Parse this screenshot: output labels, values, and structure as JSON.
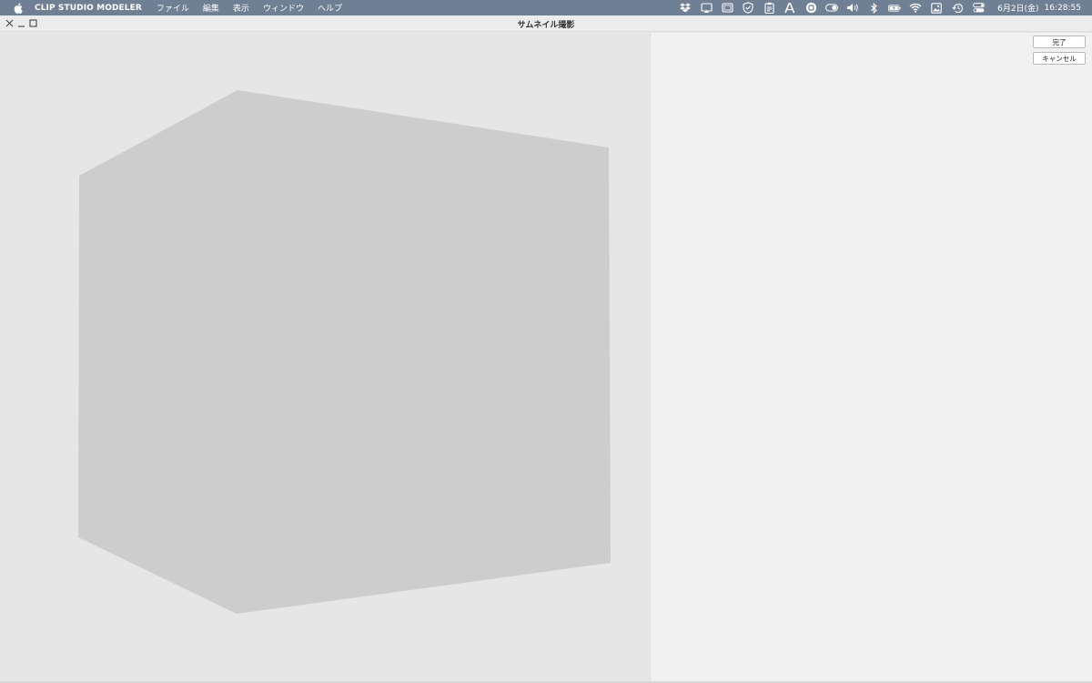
{
  "menubar": {
    "app_name": "CLIP STUDIO MODELER",
    "items": [
      "ファイル",
      "編集",
      "表示",
      "ウィンドウ",
      "ヘルプ"
    ],
    "status_icons": [
      "dropbox-icon",
      "airplay-display-icon",
      "screen-icon",
      "shield-icon",
      "clipboard-icon",
      "text-a-icon",
      "circle-s-icon",
      "toggle-icon",
      "volume-icon",
      "bluetooth-icon",
      "battery-icon",
      "wifi-icon",
      "image-icon",
      "time-machine-icon",
      "control-center-icon"
    ],
    "date": "6月2日(金)",
    "time": "16:28:55"
  },
  "window": {
    "title": "サムネイル撮影"
  },
  "panel": {
    "done_label": "完了",
    "cancel_label": "キャンセル"
  },
  "colors": {
    "menubar_bg": "#6f7f94",
    "viewport_bg": "#e6e6e6",
    "cube_fill": "#cdcdcd",
    "panel_bg": "#f1f1f1"
  }
}
